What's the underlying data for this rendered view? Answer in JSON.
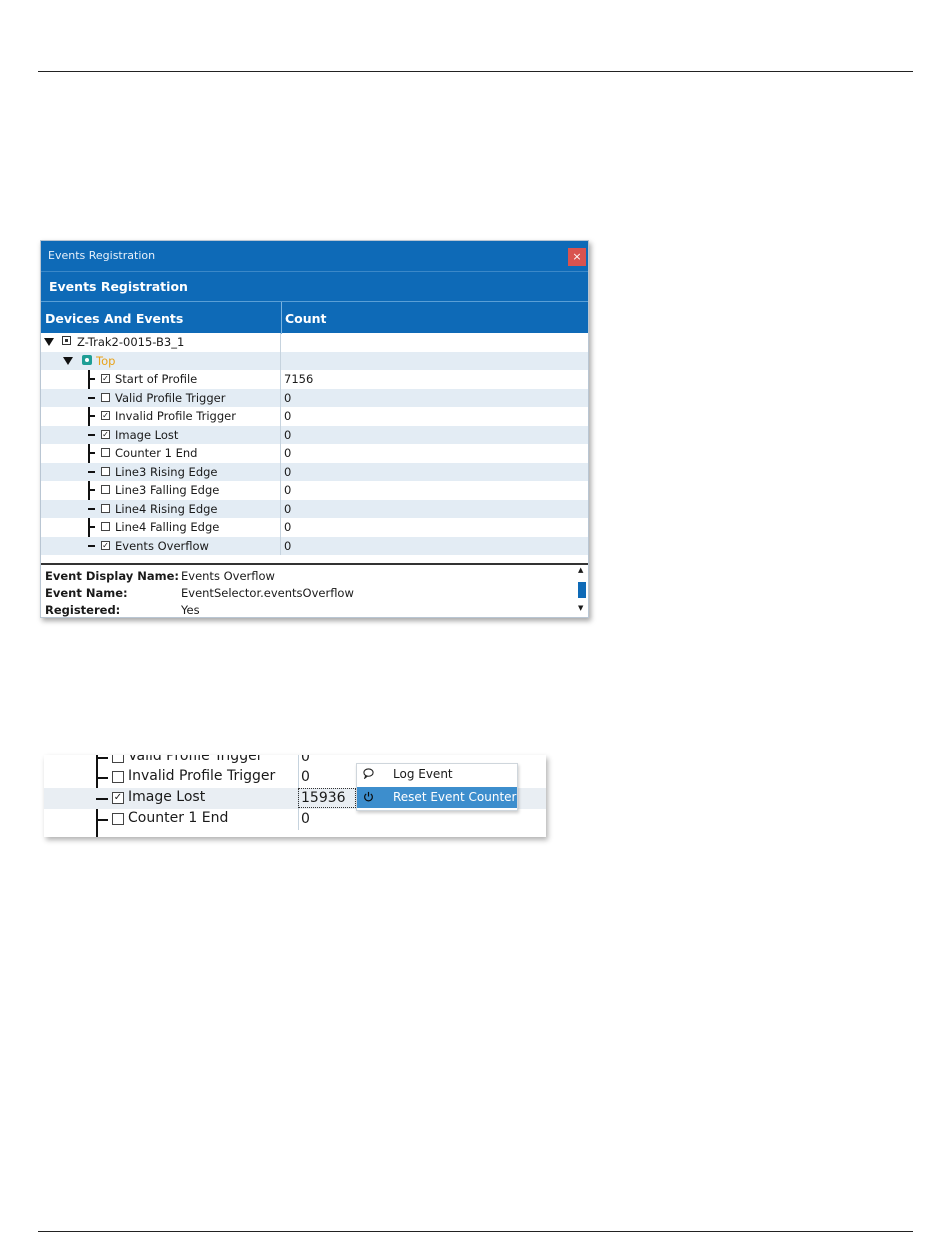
{
  "window": {
    "title": "Events Registration",
    "close_label": "×",
    "heading": "Events Registration",
    "columns": [
      "Devices And Events",
      "Count"
    ],
    "device": "Z-Trak2-0015-B3_1",
    "group": "Top",
    "events": [
      {
        "name": "Start of Profile",
        "checked": true,
        "count": "7156"
      },
      {
        "name": "Valid Profile Trigger",
        "checked": false,
        "count": "0"
      },
      {
        "name": "Invalid Profile Trigger",
        "checked": true,
        "count": "0"
      },
      {
        "name": "Image Lost",
        "checked": true,
        "count": "0"
      },
      {
        "name": "Counter 1 End",
        "checked": false,
        "count": "0"
      },
      {
        "name": "Line3 Rising Edge",
        "checked": false,
        "count": "0"
      },
      {
        "name": "Line3 Falling Edge",
        "checked": false,
        "count": "0"
      },
      {
        "name": "Line4 Rising Edge",
        "checked": false,
        "count": "0"
      },
      {
        "name": "Line4 Falling Edge",
        "checked": false,
        "count": "0"
      },
      {
        "name": "Events Overflow",
        "checked": true,
        "count": "0"
      }
    ],
    "info": [
      {
        "key": "Event Display Name:",
        "value": "Events Overflow"
      },
      {
        "key": "Event Name:",
        "value": "EventSelector.eventsOverflow"
      },
      {
        "key": "Registered:",
        "value": "Yes"
      }
    ]
  },
  "snippet": {
    "rows": [
      {
        "name": "Valid Profile Trigger",
        "checked": false,
        "count": "0"
      },
      {
        "name": "Invalid Profile Trigger",
        "checked": false,
        "count": "0"
      },
      {
        "name": "Image Lost",
        "checked": true,
        "count": "15936"
      },
      {
        "name": "Counter 1 End",
        "checked": false,
        "count": "0"
      }
    ],
    "menu": [
      {
        "label": "Log Event",
        "icon": "speech-bubble-icon"
      },
      {
        "label": "Reset Event Counter",
        "icon": "power-icon"
      }
    ]
  },
  "colors": {
    "accent": "#0e6ab7",
    "group_text": "#e8a21a",
    "selected": "#3d8ecd",
    "close": "#d9534f"
  }
}
